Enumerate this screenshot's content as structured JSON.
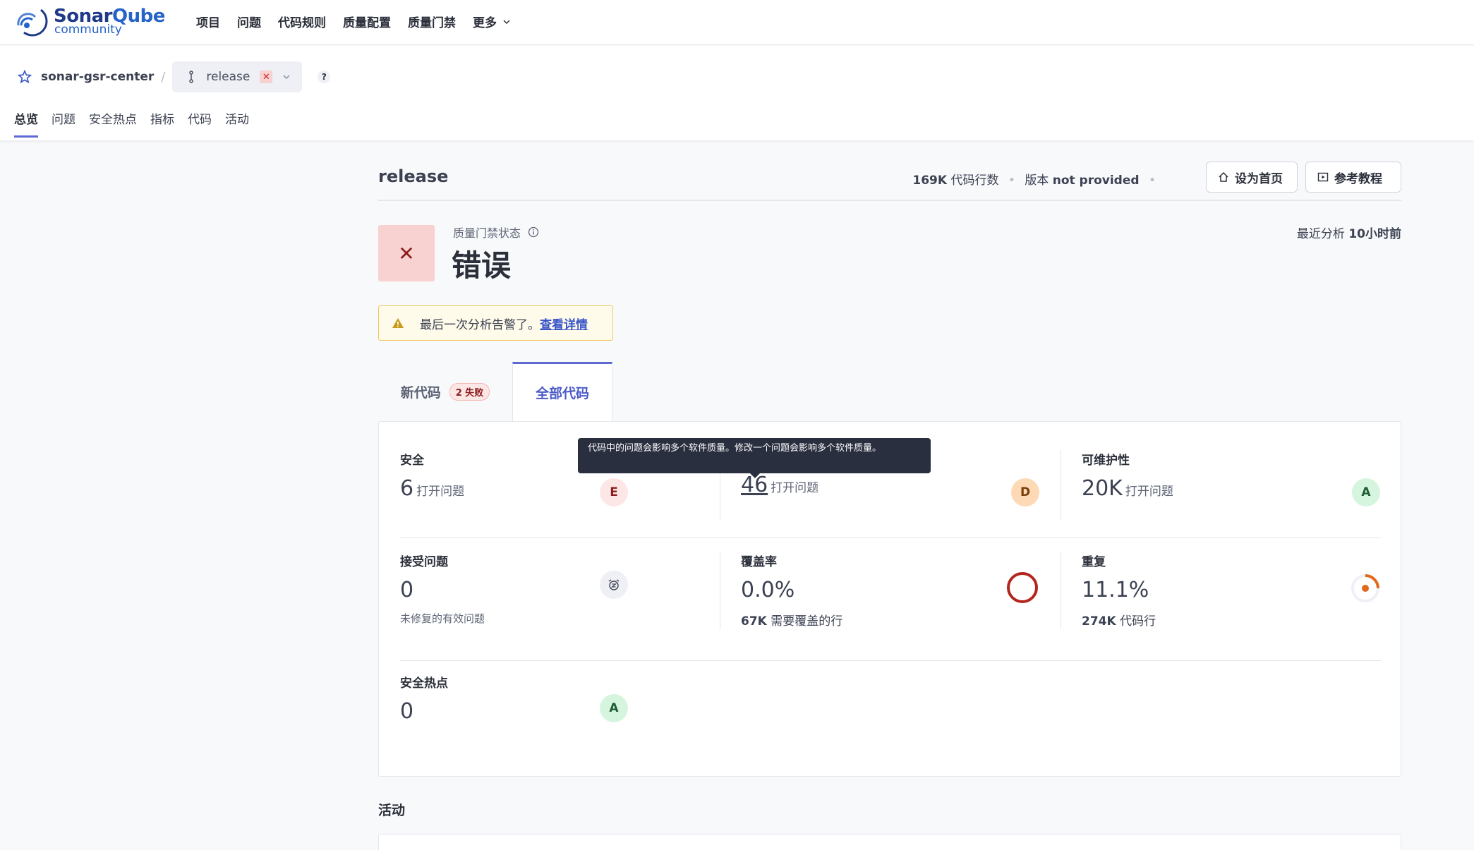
{
  "brand": {
    "name_part1": "Sonar",
    "name_part2": "Qube",
    "edition": "community"
  },
  "menu": [
    {
      "label": "项目"
    },
    {
      "label": "问题"
    },
    {
      "label": "代码规则"
    },
    {
      "label": "质量配置"
    },
    {
      "label": "质量门禁"
    },
    {
      "label": "更多"
    }
  ],
  "project": {
    "name": "sonar-gsr-center",
    "branch": "release"
  },
  "tabs": [
    {
      "label": "总览"
    },
    {
      "label": "问题"
    },
    {
      "label": "安全热点"
    },
    {
      "label": "指标"
    },
    {
      "label": "代码"
    },
    {
      "label": "活动"
    }
  ],
  "header": {
    "branch_title": "release",
    "loc_value": "169K",
    "loc_label": "代码行数",
    "version_label": "版本",
    "version_value": "not provided",
    "home_button": "设为首页",
    "tutorial_button": "参考教程"
  },
  "quality_gate": {
    "label": "质量门禁状态",
    "status": "错误",
    "status_color": "#f8d2d0",
    "last_analysis_label": "最近分析",
    "last_analysis_value": "10小时前"
  },
  "warning": {
    "text": "最后一次分析告警了。",
    "link": "查看详情"
  },
  "code_tabs": {
    "new_code": "新代码",
    "new_code_badge": "2 失败",
    "all_code": "全部代码"
  },
  "metrics": {
    "security": {
      "title": "安全",
      "value": "6",
      "unit": "打开问题",
      "rating": "E"
    },
    "reliability": {
      "value": "46",
      "unit": "打开问题",
      "rating": "D"
    },
    "maintainability": {
      "title": "可维护性",
      "value": "20K",
      "unit": "打开问题",
      "rating": "A"
    },
    "accepted": {
      "title": "接受问题",
      "value": "0",
      "sub": "未修复的有效问题"
    },
    "coverage": {
      "title": "覆盖率",
      "value": "0.0%",
      "sub_value": "67K",
      "sub_label": "需要覆盖的行"
    },
    "duplication": {
      "title": "重复",
      "value": "11.1%",
      "sub_value": "274K",
      "sub_label": "代码行"
    },
    "hotspots": {
      "title": "安全热点",
      "value": "0",
      "rating": "A"
    }
  },
  "tooltip": {
    "text": "代码中的问题会影响多个软件质量。修改一个问题会影响多个软件质量。"
  },
  "activity": {
    "title": "活动"
  }
}
